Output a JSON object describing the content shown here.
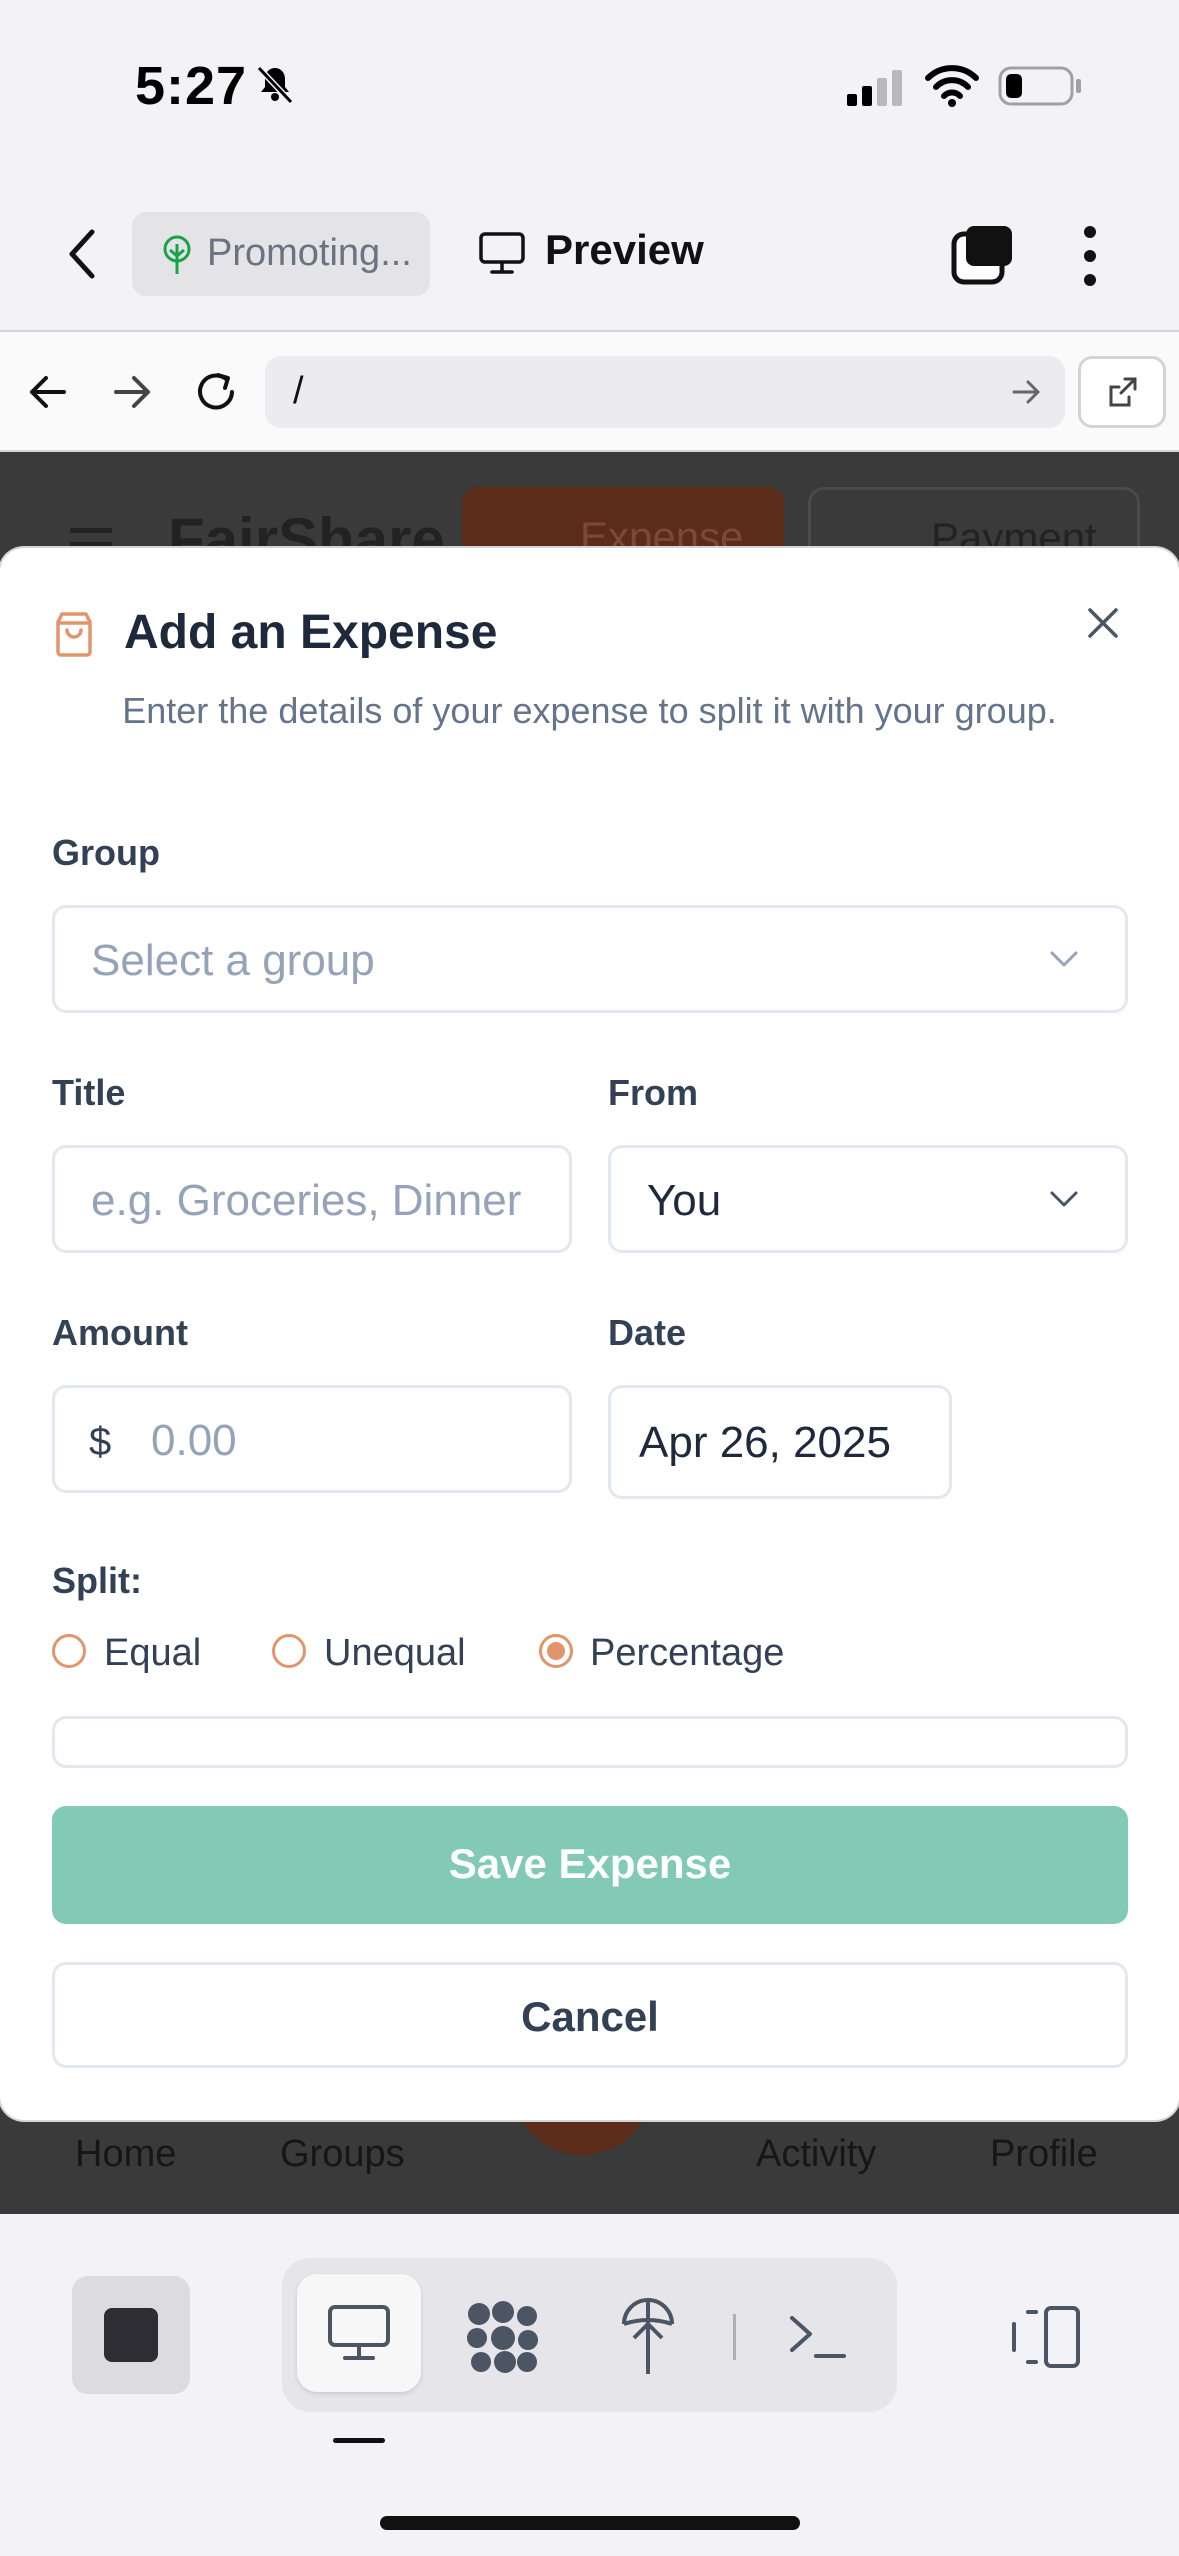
{
  "status_bar": {
    "time": "5:27"
  },
  "app_nav": {
    "project_name": "Promoting...",
    "preview_label": "Preview"
  },
  "url_bar": {
    "url": "/"
  },
  "background_app": {
    "brand": "FairShare",
    "expense_button": "Expense",
    "payment_button": "Payment",
    "tabs": [
      "Home",
      "Groups",
      "Activity",
      "Profile"
    ]
  },
  "modal": {
    "title": "Add an Expense",
    "description": "Enter the details of your expense to split it with your group.",
    "group": {
      "label": "Group",
      "placeholder": "Select a group"
    },
    "title_field": {
      "label": "Title",
      "placeholder": "e.g. Groceries, Dinner"
    },
    "from": {
      "label": "From",
      "value": "You"
    },
    "amount": {
      "label": "Amount",
      "currency": "$",
      "placeholder": "0.00"
    },
    "date": {
      "label": "Date",
      "value": "Apr 26, 2025"
    },
    "split": {
      "label": "Split:",
      "options": [
        "Equal",
        "Unequal",
        "Percentage"
      ],
      "selected": "Percentage"
    },
    "save_label": "Save Expense",
    "cancel_label": "Cancel"
  },
  "colors": {
    "accent": "#e0956a",
    "save_button": "#82cab3",
    "text_dark": "#1e293b"
  }
}
